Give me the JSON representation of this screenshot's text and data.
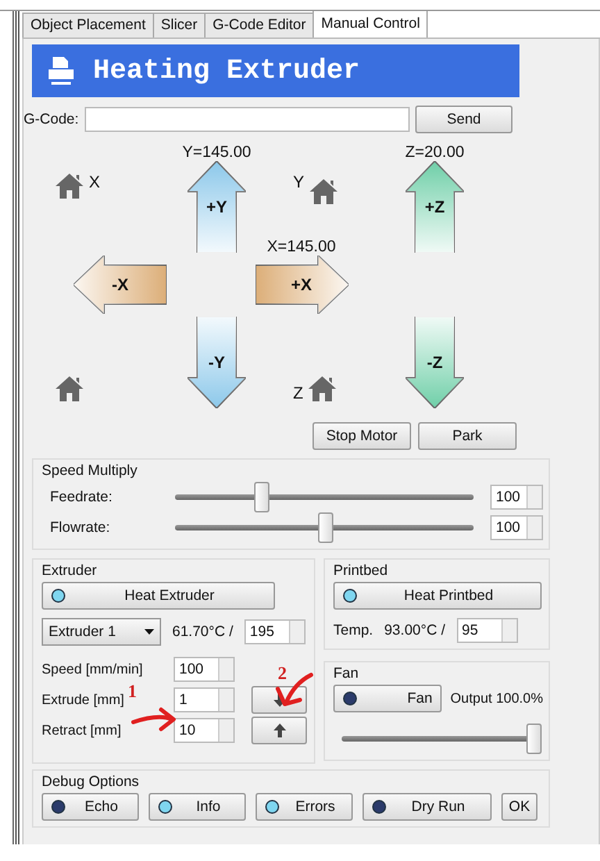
{
  "tabs": [
    {
      "label": "Object Placement",
      "selected": false
    },
    {
      "label": "Slicer",
      "selected": false
    },
    {
      "label": "G-Code Editor",
      "selected": false
    },
    {
      "label": "Manual Control",
      "selected": true
    }
  ],
  "header": {
    "title": "Heating Extruder"
  },
  "gcode": {
    "label": "G-Code:",
    "button": "Send"
  },
  "jog": {
    "y_position": "Y=145.00",
    "z_position": "Z=20.00",
    "x_position": "X=145.00",
    "homes": [
      {
        "axis_label": "X"
      },
      {
        "axis_label": "Y"
      },
      {
        "axis_label": "Z"
      }
    ],
    "arrows": [
      {
        "label": "+Y",
        "kind": "up",
        "color": "#8cc8ea"
      },
      {
        "label": "+Z",
        "kind": "up",
        "color": "#6fcfa8"
      },
      {
        "label": "-X",
        "kind": "left",
        "color": "#dcae78"
      },
      {
        "label": "+X",
        "kind": "right",
        "color": "#dcae78"
      },
      {
        "label": "-Y",
        "kind": "down",
        "color": "#8cc8ea"
      },
      {
        "label": "-Z",
        "kind": "down",
        "color": "#6fcfa8"
      }
    ],
    "actions": [
      "Stop Motor",
      "Park"
    ]
  },
  "speed": {
    "title": "Speed Multiply",
    "rows": [
      {
        "label": "Feedrate:",
        "level": 0.29,
        "value": "100"
      },
      {
        "label": "Flowrate:",
        "level": 0.5,
        "value": "100"
      }
    ]
  },
  "extruder": {
    "title": "Extruder",
    "heat_button": {
      "label": "Heat Extruder",
      "on": true
    },
    "select": "Extruder 1",
    "temp": "61.70°C /",
    "target": "195",
    "fields": [
      {
        "label": "Speed [mm/min]",
        "value": "100",
        "kind": "plain"
      },
      {
        "label": "Extrude [mm]",
        "value": "1",
        "kind": "extrude"
      },
      {
        "label": "Retract [mm]",
        "value": "10",
        "kind": "retract"
      }
    ]
  },
  "printbed": {
    "title": "Printbed",
    "heat_button": {
      "label": "Heat Printbed",
      "on": true
    },
    "temp_label": "Temp.",
    "temp": "93.00°C /",
    "target": "95"
  },
  "fan": {
    "title": "Fan",
    "button": {
      "label": "Fan",
      "on": false
    },
    "output": "Output 100.0%",
    "level": 1
  },
  "debug": {
    "title": "Debug Options",
    "toggles": [
      {
        "label": "Echo",
        "on": false
      },
      {
        "label": "Info",
        "on": true
      },
      {
        "label": "Errors",
        "on": true
      },
      {
        "label": "Dry Run",
        "on": false
      }
    ],
    "ok": "OK"
  },
  "annotations": [
    {
      "label": "1"
    },
    {
      "label": "2"
    }
  ]
}
